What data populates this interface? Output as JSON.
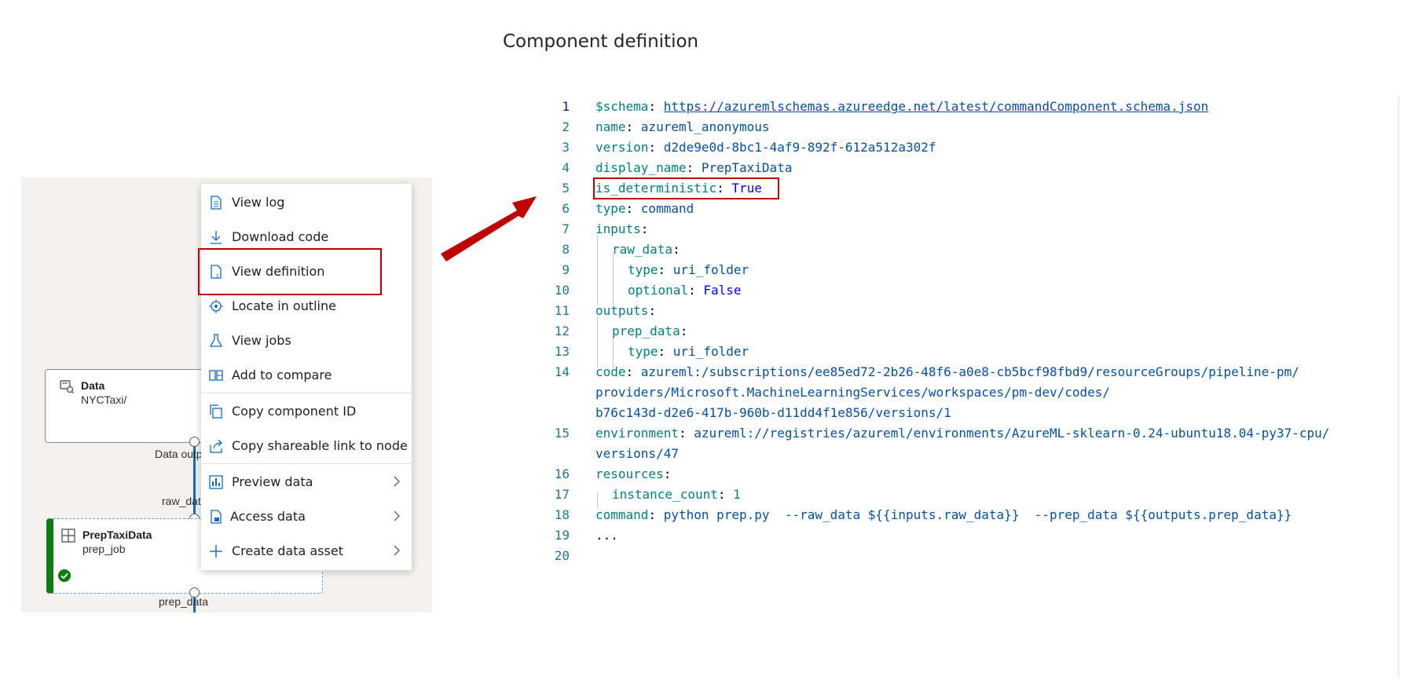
{
  "page_title": "Component definition",
  "canvas": {
    "data_node": {
      "name": "Data",
      "sub": "NYCTaxi/",
      "output_label": "Data output"
    },
    "prep_node": {
      "name": "PrepTaxiData",
      "sub": "prep_job",
      "input_label": "raw_data",
      "output_label": "prep_data",
      "status": "completed"
    }
  },
  "menu": {
    "items": [
      {
        "label": "View log",
        "icon": "document-lines-icon",
        "submenu": false
      },
      {
        "label": "Download code",
        "icon": "download-icon",
        "submenu": false
      },
      {
        "label": "View definition",
        "icon": "document-code-icon",
        "submenu": false
      },
      {
        "label": "Locate in outline",
        "icon": "locate-icon",
        "submenu": false
      },
      {
        "label": "View jobs",
        "icon": "flask-icon",
        "submenu": false
      },
      {
        "label": "Add to compare",
        "icon": "compare-icon",
        "submenu": false
      },
      {
        "label": "Copy component ID",
        "icon": "copy-icon",
        "submenu": false
      },
      {
        "label": "Copy shareable link to node",
        "icon": "share-icon",
        "submenu": false
      },
      {
        "label": "Preview data",
        "icon": "chart-icon",
        "submenu": true
      },
      {
        "label": "Access data",
        "icon": "document-lock-icon",
        "submenu": true
      },
      {
        "label": "Create data asset",
        "icon": "plus-icon",
        "submenu": true
      }
    ]
  },
  "code": {
    "line_numbers": [
      "1",
      "2",
      "3",
      "4",
      "5",
      "6",
      "7",
      "8",
      "9",
      "10",
      "11",
      "12",
      "13",
      "14",
      "15",
      "16",
      "17",
      "18",
      "19",
      "20"
    ],
    "lines": {
      "l1": {
        "key": "$schema",
        "value": "https://azuremlschemas.azureedge.net/latest/commandComponent.schema.json"
      },
      "l2": {
        "key": "name",
        "value": "azureml_anonymous"
      },
      "l3": {
        "key": "version",
        "value": "d2de9e0d-8bc1-4af9-892f-612a512a302f"
      },
      "l4": {
        "key": "display_name",
        "value": "PrepTaxiData"
      },
      "l5": {
        "key": "is_deterministic",
        "value": "True"
      },
      "l6": {
        "key": "type",
        "value": "command"
      },
      "l7": {
        "key": "inputs"
      },
      "l8": {
        "key": "raw_data"
      },
      "l9": {
        "key": "type",
        "value": "uri_folder"
      },
      "l10": {
        "key": "optional",
        "value": "False"
      },
      "l11": {
        "key": "outputs"
      },
      "l12": {
        "key": "prep_data"
      },
      "l13": {
        "key": "type",
        "value": "uri_folder"
      },
      "l14": {
        "key": "code",
        "value_1": "azureml:/subscriptions/ee85ed72-2b26-48f6-a0e8-cb5bcf98fbd9/resourceGroups/pipeline-pm/",
        "value_2": "providers/Microsoft.MachineLearningServices/workspaces/pm-dev/codes/",
        "value_3": "b76c143d-d2e6-417b-960b-d11dd4f1e856/versions/1"
      },
      "l15": {
        "key": "environment",
        "value_1": "azureml://registries/azureml/environments/AzureML-sklearn-0.24-ubuntu18.04-py37-cpu/",
        "value_2": "versions/47"
      },
      "l16": {
        "key": "resources"
      },
      "l17": {
        "key": "instance_count",
        "value": "1"
      },
      "l18": {
        "key": "command",
        "value": "python prep.py  --raw_data ${{inputs.raw_data}}  --prep_data ${{outputs.prep_data}}"
      },
      "l19": {
        "text": "..."
      }
    }
  },
  "colors": {
    "highlight_box": "#c00000",
    "arrow": "#c00000",
    "yaml_key": "#008080",
    "yaml_value": "#0451a5",
    "yaml_keyword": "#0000ff",
    "status_success": "#107c10",
    "wire": "#0f6cbd"
  }
}
